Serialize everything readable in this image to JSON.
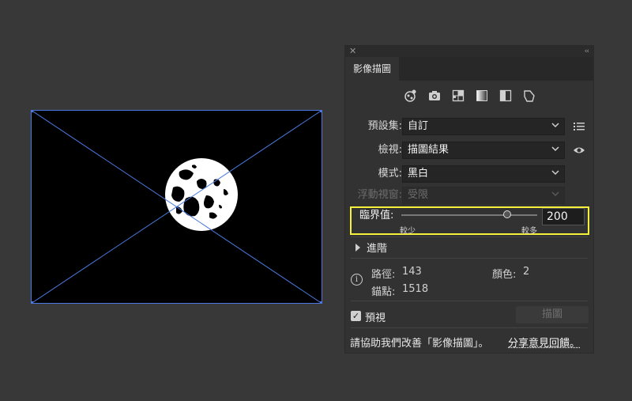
{
  "panel": {
    "tab_label": "影像描圖",
    "close_label": "✕",
    "collapse_label": "‹‹",
    "icons": [
      "auto-color-icon",
      "camera-icon",
      "grid-icon",
      "grayscale-icon",
      "black-white-icon",
      "outline-icon"
    ],
    "preset": {
      "label": "預設集:",
      "value": "自訂"
    },
    "view": {
      "label": "檢視:",
      "value": "描圖結果"
    },
    "mode": {
      "label": "模式:",
      "value": "黑白"
    },
    "palette": {
      "label": "浮動視窗:",
      "value": "受限"
    },
    "threshold": {
      "label": "臨界值:",
      "value": "200",
      "fraction": 0.78,
      "less_label": "較少",
      "more_label": "較多"
    },
    "advanced_label": "進階",
    "stats": {
      "paths_label": "路徑:",
      "paths_value": "143",
      "colors_label": "顏色:",
      "colors_value": "2",
      "anchors_label": "錨點:",
      "anchors_value": "1518"
    },
    "preview_label": "預視",
    "trace_button": "描圖",
    "help_text": "請協助我們改善「影像描圖」。",
    "help_link": "分享意見回饋。"
  }
}
